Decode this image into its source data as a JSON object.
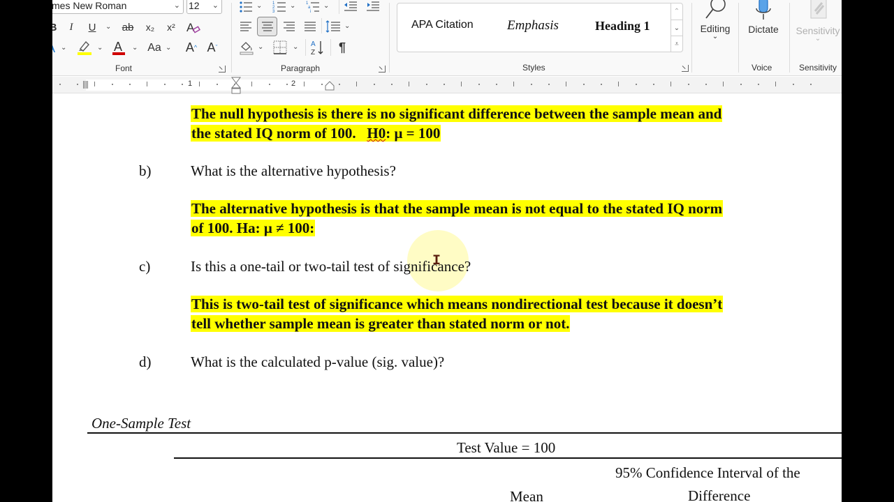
{
  "ribbon": {
    "font": {
      "font_name": "Times New Roman",
      "font_name_visible": "mes New Roman",
      "font_size": "12",
      "label": "Font",
      "buttons": {
        "bold": "B",
        "italic": "I",
        "underline": "U",
        "strikethrough": "ab",
        "subscript": "x₂",
        "superscript": "x²",
        "change_case": "Aa",
        "grow_font": "A",
        "shrink_font": "A",
        "font_color": "A"
      },
      "highlight_color": "#ffff00",
      "font_color_value": "#d00000"
    },
    "paragraph": {
      "label": "Paragraph",
      "pilcrow": "¶",
      "active_alignment": "center"
    },
    "styles": {
      "label": "Styles",
      "items": [
        "APA Citation",
        "Emphasis",
        "Heading 1"
      ]
    },
    "editing": {
      "label": "Editing"
    },
    "voice": {
      "label": "Dictate",
      "group_label": "Voice"
    },
    "sensitivity": {
      "label": "Sensitivity",
      "group_label": "Sensitivity"
    }
  },
  "ruler": {
    "numbers": [
      "1",
      "2"
    ]
  },
  "document": {
    "answer_a": {
      "line1": "The null hypothesis is there is no significant difference between the sample mean and",
      "line2_pre": "the stated IQ norm of 100.   ",
      "line2_spell": "H0",
      "line2_post": ": μ = 100"
    },
    "question_b": {
      "label": "b)",
      "text": "What is the alternative hypothesis?"
    },
    "answer_b": {
      "line1": "The alternative hypothesis is that the sample mean is not equal to the stated IQ norm",
      "line2": "of 100.  Ha: μ ≠ 100:"
    },
    "question_c": {
      "label": "c)",
      "text": "Is this a one-tail or two-tail test of significance?"
    },
    "answer_c": {
      "line1": "This is two-tail test of significance which means nondirectional test because it doesn’t",
      "line2": "tell whether sample mean is greater than stated norm or not."
    },
    "question_d": {
      "label": "d)",
      "text": "What is the calculated p-value (sig. value)?"
    },
    "table": {
      "title": "One-Sample Test",
      "test_value_header": "Test Value = 100",
      "columns": [
        "Mean",
        "95% Confidence Interval of the",
        "Difference"
      ]
    }
  }
}
